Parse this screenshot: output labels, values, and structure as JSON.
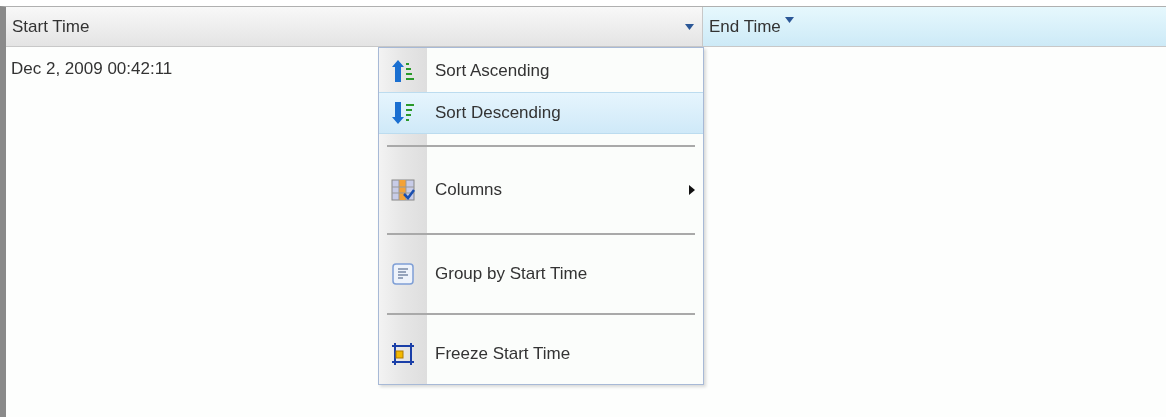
{
  "table": {
    "columns": [
      {
        "label": "Start Time",
        "highlighted": false,
        "menu_button": true
      },
      {
        "label": "End Time",
        "highlighted": true,
        "menu_button": false
      }
    ],
    "rows": [
      [
        "Dec 2, 2009 00:42:11",
        ""
      ]
    ]
  },
  "menu": {
    "items": [
      {
        "kind": "item",
        "label": "Sort Ascending",
        "selected": false,
        "submenu": false
      },
      {
        "kind": "item",
        "label": "Sort Descending",
        "selected": true,
        "submenu": false
      },
      {
        "kind": "separator"
      },
      {
        "kind": "item",
        "label": "Columns",
        "selected": false,
        "submenu": true
      },
      {
        "kind": "separator"
      },
      {
        "kind": "item",
        "label": "Group by Start Time",
        "selected": false,
        "submenu": false
      },
      {
        "kind": "separator"
      },
      {
        "kind": "item",
        "label": "Freeze Start Time",
        "selected": false,
        "submenu": false
      }
    ]
  }
}
